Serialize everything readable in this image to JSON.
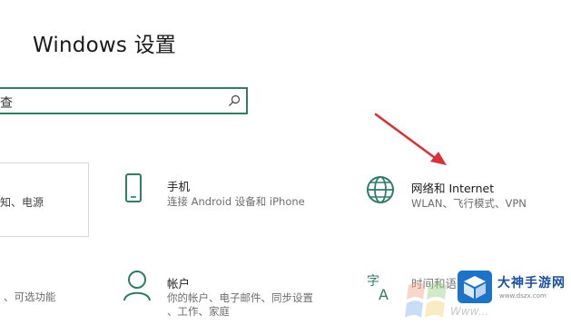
{
  "window": {
    "title": "Windows 设置"
  },
  "search": {
    "value": "查"
  },
  "tiles": {
    "system": {
      "desc": "知、电源"
    },
    "phone": {
      "title": "手机",
      "desc": "连接 Android 设备和 iPhone"
    },
    "network": {
      "title": "网络和 Internet",
      "desc": "WLAN、飞行模式、VPN"
    },
    "ease": {
      "desc_line1": "、可选功能",
      "desc_line2": ""
    },
    "account": {
      "title": "帐户",
      "desc_line1": "你的帐户、电子邮件、同步设置",
      "desc_line2": "、工作、家庭"
    },
    "time": {
      "title": "时间和语言"
    }
  },
  "watermark": {
    "brand": "大神手游网",
    "url": "www.dszx.com",
    "faint_text": "Www..."
  },
  "colors": {
    "accent": "#2f7d63",
    "icon": "#2e7d68",
    "arrow": "#d6323a",
    "logo": "#1d73c7"
  },
  "icons": {
    "search": "search-icon",
    "phone": "phone-icon",
    "network": "globe-icon",
    "account": "person-icon",
    "time": "language-icon"
  }
}
